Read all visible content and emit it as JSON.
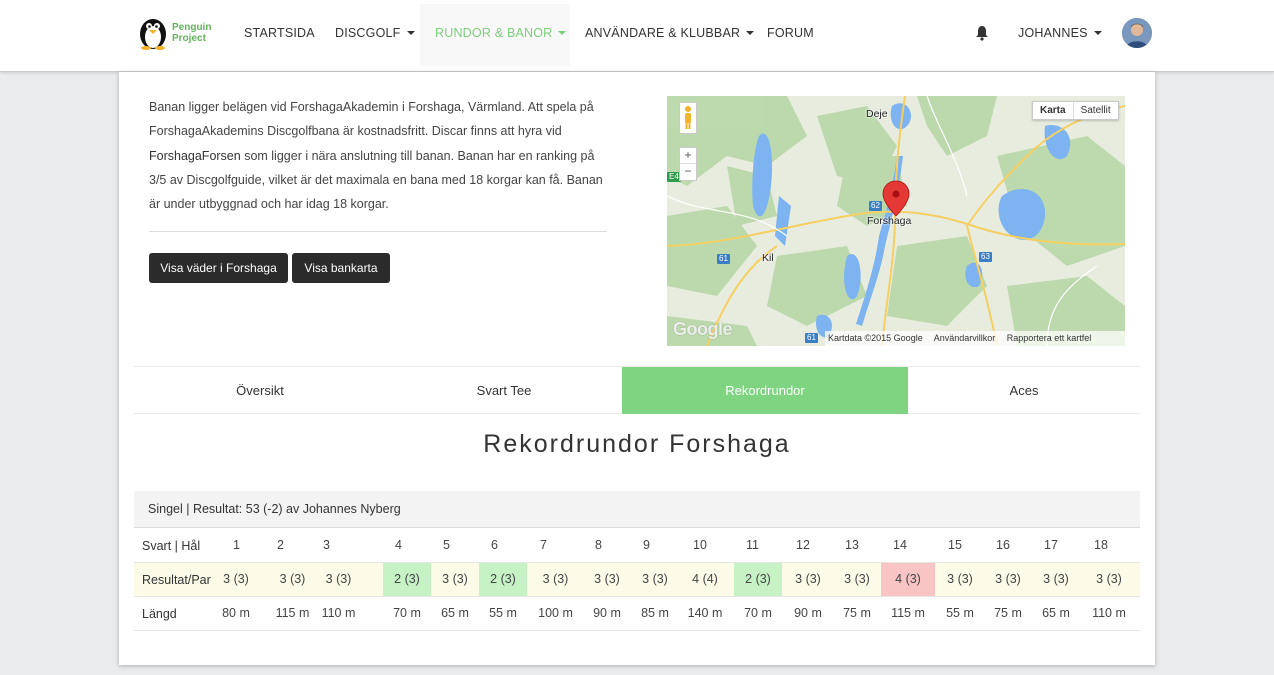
{
  "nav": {
    "logo_line1": "Penguin",
    "logo_line2": "Project",
    "items": [
      {
        "label": "STARTSIDA",
        "dropdown": false,
        "active": false
      },
      {
        "label": "DISCGOLF",
        "dropdown": true,
        "active": false
      },
      {
        "label": "RUNDOR & BANOR",
        "dropdown": true,
        "active": true
      },
      {
        "label": "ANVÄNDARE & KLUBBAR",
        "dropdown": true,
        "active": false
      },
      {
        "label": "FORUM",
        "dropdown": false,
        "active": false
      }
    ],
    "user": "JOHANNES",
    "bell_icon": "bell-icon",
    "accent": "#7ccf7c"
  },
  "description": {
    "line1": "Banan ligger belägen vid ForshagaAkademin i Forshaga, Värmland. Att spela på",
    "line2": "ForshagaAkademins Discgolfbana är kostnadsfritt. Discar finns att hyra vid",
    "line3_bold": "ForshagaForsen",
    "line3_rest": " som ligger i nära anslutning till banan. Banan har en ranking på",
    "line4": "3/5 av Discgolfguide, vilket är det maximala en bana med 18 korgar kan få. Banan",
    "line5": "är under utbyggnad och har idag 18 korgar."
  },
  "buttons": {
    "weather": "Visa väder i Forshaga",
    "course_map": "Visa bankarta"
  },
  "map": {
    "toggle_map": "Karta",
    "toggle_satellite": "Satellit",
    "zoom_in": "+",
    "zoom_out": "−",
    "google": "Google",
    "footer": [
      "Kartdata ©2015 Google",
      "Användarvillkor",
      "Rapportera ett kartfel"
    ],
    "places": [
      "Deje",
      "Forshaga",
      "Kil"
    ],
    "road_shields": [
      "62",
      "61",
      "63",
      "61",
      "E45"
    ]
  },
  "tabs": [
    {
      "label": "Översikt",
      "active": false
    },
    {
      "label": "Svart Tee",
      "active": false
    },
    {
      "label": "Rekordrundor",
      "active": true
    },
    {
      "label": "Aces",
      "active": false
    }
  ],
  "section_title": "Rekordrundor Forshaga",
  "record": {
    "header": "Singel | Resultat: 53 (-2) av Johannes Nyberg",
    "row_labels": {
      "holes": "Svart | Hål",
      "results": "Resultat/Par",
      "lengths": "Längd"
    },
    "holes": [
      "1",
      "2",
      "3",
      "4",
      "5",
      "6",
      "7",
      "8",
      "9",
      "10",
      "11",
      "12",
      "13",
      "14",
      "15",
      "16",
      "17",
      "18"
    ],
    "results": [
      {
        "text": "3 (3)",
        "status": "par"
      },
      {
        "text": "3 (3)",
        "status": "par"
      },
      {
        "text": "3 (3)",
        "status": "par"
      },
      {
        "text": "2 (3)",
        "status": "birdie"
      },
      {
        "text": "3 (3)",
        "status": "par"
      },
      {
        "text": "2 (3)",
        "status": "birdie"
      },
      {
        "text": "3 (3)",
        "status": "par"
      },
      {
        "text": "3 (3)",
        "status": "par"
      },
      {
        "text": "3 (3)",
        "status": "par"
      },
      {
        "text": "4 (4)",
        "status": "par"
      },
      {
        "text": "2 (3)",
        "status": "birdie"
      },
      {
        "text": "3 (3)",
        "status": "par"
      },
      {
        "text": "3 (3)",
        "status": "par"
      },
      {
        "text": "4 (3)",
        "status": "bogey"
      },
      {
        "text": "3 (3)",
        "status": "par"
      },
      {
        "text": "3 (3)",
        "status": "par"
      },
      {
        "text": "3 (3)",
        "status": "par"
      },
      {
        "text": "3 (3)",
        "status": "par"
      }
    ],
    "lengths": [
      "80 m",
      "115 m",
      "110 m",
      "70 m",
      "65 m",
      "55 m",
      "100 m",
      "90 m",
      "85 m",
      "140 m",
      "70 m",
      "90 m",
      "75 m",
      "115 m",
      "55 m",
      "75 m",
      "65 m",
      "110 m"
    ],
    "colors": {
      "birdie": "#c6f2c6",
      "bogey": "#f8c4c4",
      "par_row": "#fbfbe8"
    }
  }
}
